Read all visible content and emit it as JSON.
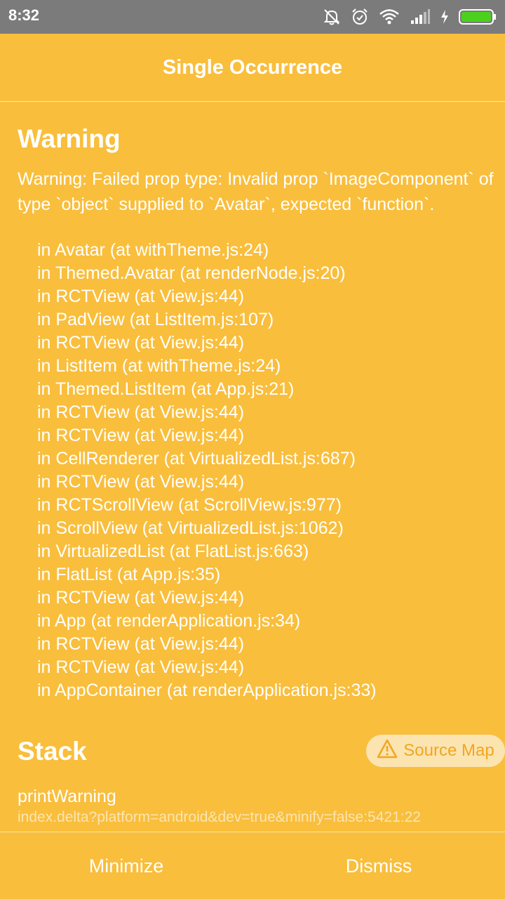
{
  "status_bar": {
    "time": "8:32",
    "icons": [
      "notifications-muted-icon",
      "alarm-icon",
      "wifi-icon",
      "cellular-signal-icon",
      "charging-icon",
      "battery-icon"
    ]
  },
  "header": {
    "title": "Single Occurrence"
  },
  "warning": {
    "title": "Warning",
    "message": "Warning: Failed prop type: Invalid prop `ImageComponent` of type `object` supplied to `Avatar`, expected `function`.",
    "trace": [
      "in Avatar (at withTheme.js:24)",
      "in Themed.Avatar (at renderNode.js:20)",
      "in RCTView (at View.js:44)",
      "in PadView (at ListItem.js:107)",
      "in RCTView (at View.js:44)",
      "in ListItem (at withTheme.js:24)",
      "in Themed.ListItem (at App.js:21)",
      "in RCTView (at View.js:44)",
      "in RCTView (at View.js:44)",
      "in CellRenderer (at VirtualizedList.js:687)",
      "in RCTView (at View.js:44)",
      "in RCTScrollView (at ScrollView.js:977)",
      "in ScrollView (at VirtualizedList.js:1062)",
      "in VirtualizedList (at FlatList.js:663)",
      "in FlatList (at App.js:35)",
      "in RCTView (at View.js:44)",
      "in App (at renderApplication.js:34)",
      "in RCTView (at View.js:44)",
      "in RCTView (at View.js:44)",
      "in AppContainer (at renderApplication.js:33)"
    ]
  },
  "stack": {
    "title": "Stack",
    "source_map_label": "Source Map",
    "frames": [
      {
        "name": "printWarning",
        "location": "index.delta?platform=android&dev=true&minify=false:5421:22"
      }
    ]
  },
  "footer": {
    "minimize_label": "Minimize",
    "dismiss_label": "Dismiss"
  },
  "colors": {
    "background": "#F9BE3C",
    "status_bar": "#7B7B7B",
    "source_map_bg": "#FCE4B0",
    "source_map_text": "#F2A61F",
    "battery": "#4CD01E"
  }
}
